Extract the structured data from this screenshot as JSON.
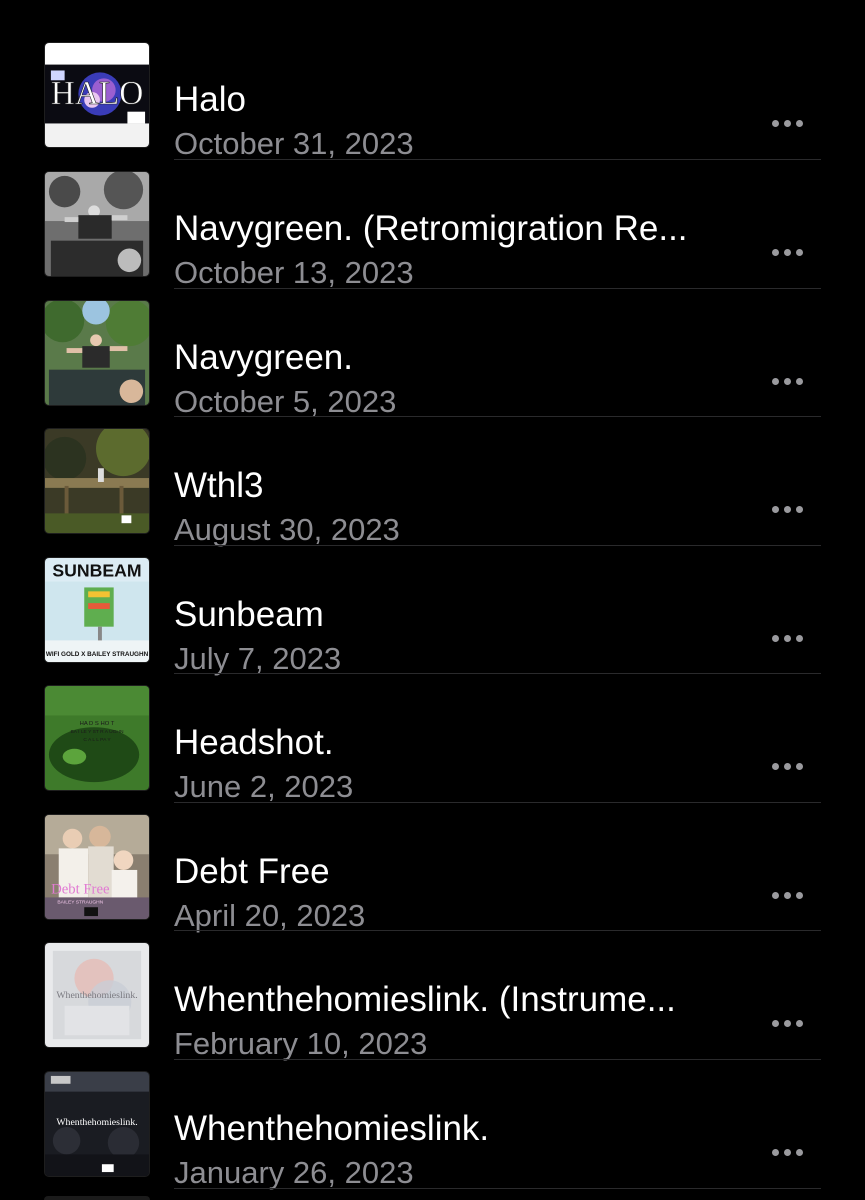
{
  "releases": [
    {
      "title": "Halo",
      "date": "October 31, 2023",
      "art": "halo-cover"
    },
    {
      "title": "Navygreen. (Retromigration Re...",
      "date": "October 13, 2023",
      "art": "navygreen-retromigration-cover"
    },
    {
      "title": "Navygreen.",
      "date": "October 5, 2023",
      "art": "navygreen-cover"
    },
    {
      "title": "Wthl3",
      "date": "August 30, 2023",
      "art": "wthl3-cover"
    },
    {
      "title": "Sunbeam",
      "date": "July 7, 2023",
      "art": "sunbeam-cover"
    },
    {
      "title": "Headshot.",
      "date": "June 2, 2023",
      "art": "headshot-cover"
    },
    {
      "title": "Debt Free",
      "date": "April 20, 2023",
      "art": "debt-free-cover"
    },
    {
      "title": "Whenthehomieslink. (Instrume...",
      "date": "February 10, 2023",
      "art": "whenthehomieslink-instrumental-cover"
    },
    {
      "title": "Whenthehomieslink.",
      "date": "January 26, 2023",
      "art": "whenthehomieslink-cover"
    }
  ],
  "art_text": {
    "halo": "HALO",
    "sunbeam": "SUNBEAM",
    "sunbeam_credit": "WIFI GOLD X BAILEY STRAUGHN",
    "headshot_line1": "HA D S HO T",
    "headshot_line2": "BA I LE Y ST R A UGHN",
    "headshot_line3": "C A L L PA Y",
    "debt_free": "Debt Free",
    "debt_free_artist": "BAILEY STRAUGHN",
    "whenthehomieslink_instrumental": "Whenthehomieslink.",
    "whenthehomieslink": "Whenthehomieslink."
  },
  "more_icon": "ellipsis-icon",
  "colors": {
    "background": "#000000",
    "title": "#ffffff",
    "date": "#8d8d92",
    "separator": "#2a2a2c",
    "dots": "#9a9a9e"
  }
}
